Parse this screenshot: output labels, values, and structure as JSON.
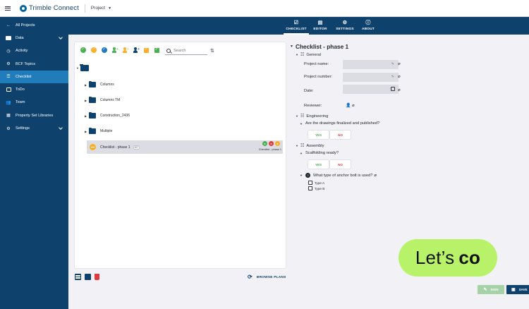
{
  "topbar": {
    "app_name": "Trimble Connect",
    "project_label": "Project"
  },
  "sidebar": {
    "items": [
      {
        "label": "All Projects",
        "icon": "back-arrow-icon"
      },
      {
        "label": "Data",
        "icon": "folder-icon",
        "expandable": true
      },
      {
        "label": "Activity",
        "icon": "clock-icon"
      },
      {
        "label": "BCF Topics",
        "icon": "bcf-icon"
      },
      {
        "label": "Checklist",
        "icon": "checklist-icon",
        "active": true
      },
      {
        "label": "ToDo",
        "icon": "todo-icon"
      },
      {
        "label": "Team",
        "icon": "team-icon"
      },
      {
        "label": "Property Set Libraries",
        "icon": "library-icon"
      },
      {
        "label": "Settings",
        "icon": "gear-icon",
        "expandable": true
      }
    ]
  },
  "tabs": [
    {
      "label": "CHECKLIST",
      "icon": "checklist-icon",
      "active": true
    },
    {
      "label": "EDITOR",
      "icon": "editor-icon"
    },
    {
      "label": "SETTINGS",
      "icon": "gear-icon"
    },
    {
      "label": "ABOUT",
      "icon": "info-icon"
    }
  ],
  "left_panel": {
    "search_placeholder": "Search",
    "folders": [
      "Columns",
      "Columns TM",
      "Construction_2436",
      "Multiple"
    ],
    "checklist_item": {
      "name": "Checklist - phase 1",
      "count": "0/7",
      "status_label": "Checklist - phase 1"
    }
  },
  "bottom_left": {
    "browse_label": "BROWSE PLANS"
  },
  "form": {
    "title": "Checklist - phase 1",
    "general": {
      "label": "General",
      "project_name_label": "Project name:",
      "project_number_label": "Project number:",
      "date_label": "Date:",
      "reviewer_label": "Reviewer:"
    },
    "engineering": {
      "label": "Engineering",
      "question": "Are the drawings finalized and published?",
      "yes": "YES",
      "no": "NO"
    },
    "assembly": {
      "label": "Assembly",
      "question": "Scaffolding ready?",
      "yes": "YES",
      "no": "NO"
    },
    "anchor": {
      "question": "What type of anchor bolt is used?",
      "options": [
        "Type A",
        "Type B"
      ]
    }
  },
  "promo": {
    "text_regular": "Let’s",
    "text_bold": "co"
  },
  "actions": {
    "sign": "SIGN",
    "save": "SAVE"
  },
  "colors": {
    "navy": "#0e416c",
    "active_blue": "#217cbb",
    "promo_green": "#b7f269",
    "yes_green": "#4caf50",
    "no_red": "#e0393e"
  }
}
